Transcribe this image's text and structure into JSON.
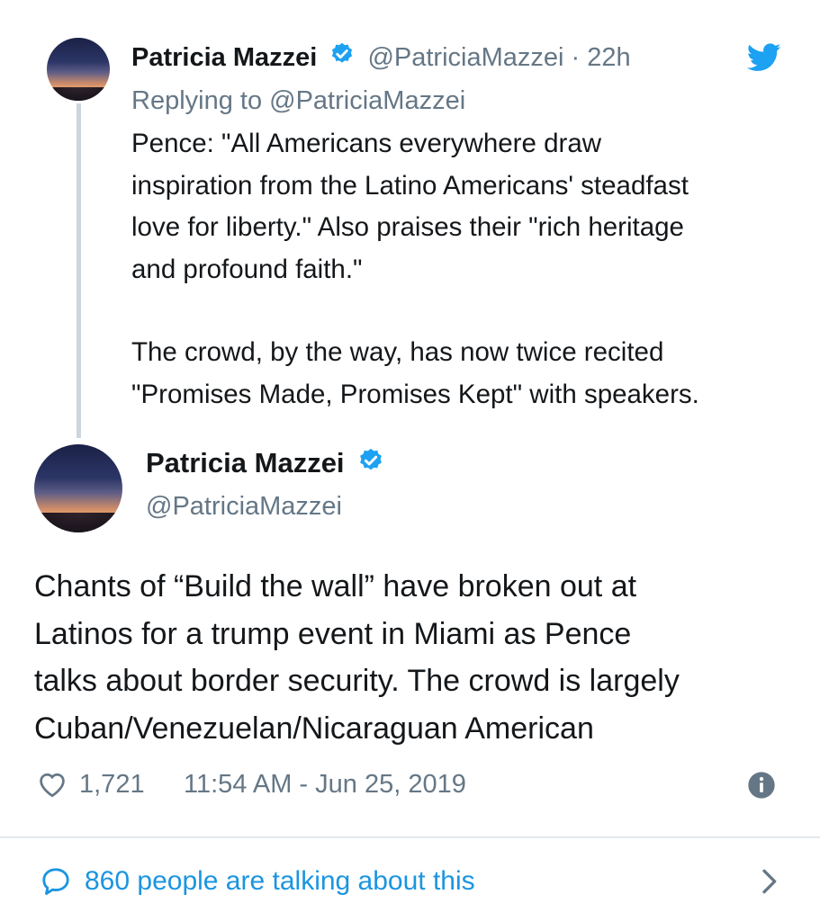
{
  "tweet1": {
    "name": "Patricia Mazzei",
    "handle": "@PatriciaMazzei",
    "separator": " · ",
    "time": "22h",
    "replying_to": "Replying to @PatriciaMazzei",
    "para1_lines": [
      "Pence: \"All Americans everywhere draw",
      "inspiration from the Latino Americans' steadfast",
      "love for liberty.\" Also praises their \"rich heritage",
      "and profound faith.\""
    ],
    "para2_lines": [
      "The crowd, by the way, has now twice recited",
      "\"Promises Made, Promises Kept\" with speakers."
    ]
  },
  "tweet2": {
    "name": "Patricia Mazzei",
    "handle": "@PatriciaMazzei",
    "body_lines": [
      "Chants of “Build the wall” have broken out at",
      "Latinos for a trump event in Miami as Pence",
      "talks about border security. The crowd is largely",
      "Cuban/Venezuelan/Nicaraguan American"
    ],
    "likes": "1,721",
    "timestamp": "11:54 AM - Jun 25, 2019"
  },
  "footer": {
    "talking": "860 people are talking about this"
  },
  "icons": {
    "brand": "twitter-bird-icon",
    "verified": "verified-badge-icon",
    "like": "heart-icon",
    "info": "info-icon",
    "reply": "speech-bubble-icon",
    "chevron": "chevron-right-icon"
  },
  "colors": {
    "twitter_blue": "#1da1f2",
    "link_blue": "#1b95e0",
    "text": "#14171a",
    "muted": "#657786",
    "divider": "#e1e8ed"
  }
}
